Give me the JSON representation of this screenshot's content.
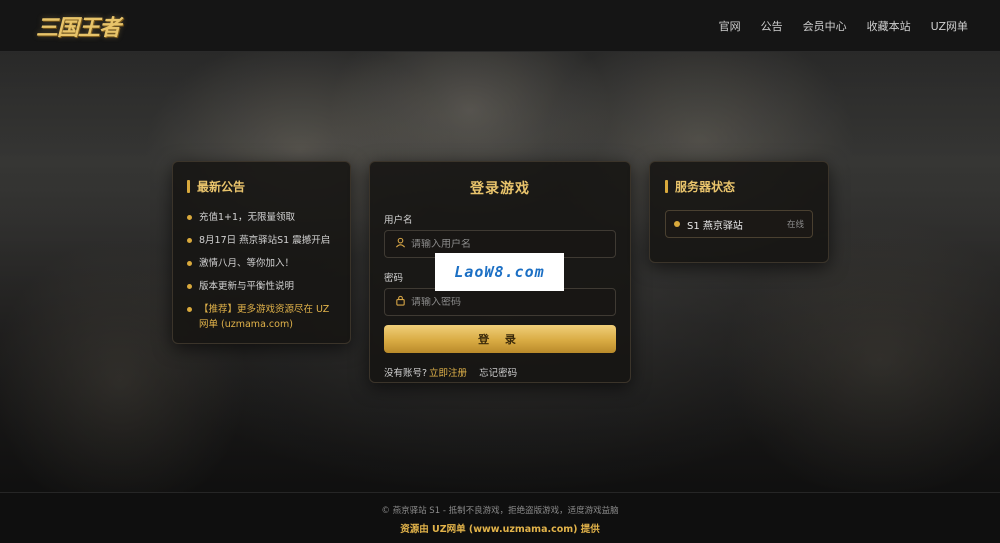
{
  "header": {
    "logo": "三国王者",
    "nav": [
      "官网",
      "公告",
      "会员中心",
      "收藏本站",
      "UZ网单"
    ]
  },
  "notice": {
    "title": "最新公告",
    "items": [
      "充值1+1，无限量领取",
      "8月17日 燕京驿站S1 震撼开启",
      "激情八月、等你加入！",
      "版本更新与平衡性说明",
      "【推荐】更多游戏资源尽在 UZ网单 (uzmama.com)"
    ]
  },
  "login": {
    "title": "登录游戏",
    "username_label": "用户名",
    "username_placeholder": "请输入用户名",
    "password_label": "密码",
    "password_placeholder": "请输入密码",
    "submit_label": "登 录",
    "no_account": "没有账号?",
    "register_link": "立即注册",
    "forgot_link": "忘记密码"
  },
  "watermark": "LaoW8.com",
  "status": {
    "title": "服务器状态",
    "server_name": "S1 燕京驿站",
    "server_state": "在线"
  },
  "footer": {
    "line1": "© 燕京驿站 S1 - 抵制不良游戏，拒绝盗版游戏，适度游戏益脑",
    "line2": "资源由 UZ网单 (www.uzmama.com) 提供"
  },
  "colors": {
    "accent": "#e9c46c",
    "button_gold": "#d9ab43",
    "panel_bg": "#161412"
  }
}
